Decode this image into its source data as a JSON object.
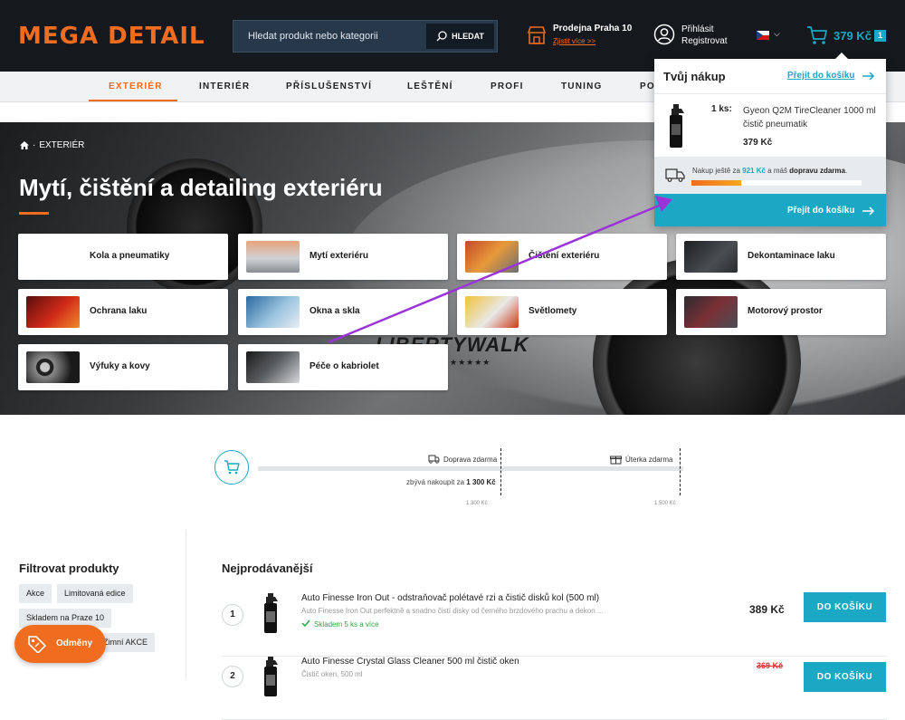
{
  "header": {
    "logo": "MEGA DETAIL",
    "search_placeholder": "Hledat produkt nebo kategorii",
    "search_button": "HLEDAT",
    "store_name": "Prodejna Praha 10",
    "store_link": "Zjistit více >>",
    "account_login": "Přihlásit",
    "account_register": "Registrovat",
    "cart_total": "379 Kč",
    "cart_count": "1"
  },
  "nav": {
    "items": [
      "EXTERIÉR",
      "INTERIÉR",
      "PŘÍSLUŠENSTVÍ",
      "LEŠTĚNÍ",
      "PROFI",
      "TUNING",
      "PO"
    ],
    "active_index": 0
  },
  "breadcrumb": {
    "current": "EXTERIÉR"
  },
  "page": {
    "title": "Mytí, čištění a detailing exteriéru"
  },
  "categories": [
    {
      "label": "Kola a pneumatiky"
    },
    {
      "label": "Mytí exteriéru"
    },
    {
      "label": "Čištění exteriéru"
    },
    {
      "label": "Dekontaminace laku"
    },
    {
      "label": "Ochrana laku"
    },
    {
      "label": "Okna a skla"
    },
    {
      "label": "Světlomety"
    },
    {
      "label": "Motorový prostor"
    },
    {
      "label": "Výfuky a kovy"
    },
    {
      "label": "Péče o kabriolet"
    }
  ],
  "hero_decor": {
    "brand_text": "LIBERTYWALK",
    "stars": "★★★★★"
  },
  "cart_popover": {
    "title": "Tvůj nákup",
    "header_link": "Přejít do košíku",
    "item": {
      "qty": "1 ks:",
      "name": "Gyeon Q2M TireCleaner 1000 ml čistič pneumatik",
      "price": "379 Kč"
    },
    "shipping": {
      "prefix": "Nakup ještě za ",
      "amount": "921 Kč",
      "middle": " a máš ",
      "bold": "dopravu zdarma",
      "suffix": ".",
      "progress": 0.29
    },
    "button": "Přejít do košíku"
  },
  "shipping_widget": {
    "free_shipping_label": "Doprava zdarma",
    "tuesday_label": "Úterka zdarma",
    "remaining_prefix": "zbývá nakoupit za ",
    "remaining_amount": "1 300 Kč",
    "threshold1": "1 300 Kč",
    "threshold2": "1 500 Kč"
  },
  "filters": {
    "title": "Filtrovat produkty",
    "tags": [
      "Akce",
      "Limitovaná edice",
      "Skladem na Praze 10",
      "Zimní AKCE"
    ]
  },
  "rewards": {
    "label": "Odměny"
  },
  "products": {
    "title": "Nejprodávanější",
    "items": [
      {
        "rank": "1",
        "name": "Auto Finesse Iron Out - odstraňovač polétavé rzi a čistič disků kol (500 ml)",
        "desc": "Auto Finesse Iron Out perfektně a snadno čistí disky od černého brzdového prachu a dekon ...",
        "stock": "Skladem 5 ks a více",
        "price": "389 Kč",
        "old_price": "",
        "button": "DO KOŠÍKU"
      },
      {
        "rank": "2",
        "name": "Auto Finesse Crystal Glass Cleaner 500 ml čistič oken",
        "desc": "Čistič oken, 500 ml",
        "stock": "",
        "price": "",
        "old_price": "369 Kč",
        "button": "DO KOŠÍKU"
      }
    ]
  },
  "colors": {
    "brand_orange": "#f06d1f",
    "accent_teal": "#1ba8c5",
    "header_bg": "#15181d",
    "annotation_arrow": "#9b34d8"
  }
}
